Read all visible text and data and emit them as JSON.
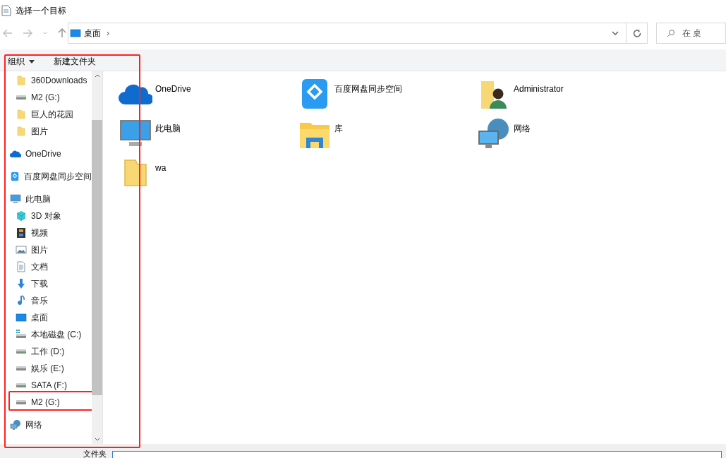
{
  "window": {
    "title": "选择一个目标"
  },
  "address_bar": {
    "location": "桌面",
    "separator": "›"
  },
  "search": {
    "placeholder": "在 桌"
  },
  "toolbar": {
    "organize": "组织",
    "new_folder": "新建文件夹"
  },
  "sidebar": {
    "annotated": true,
    "pinned_items": [
      {
        "label": "360Downloads",
        "kind": "folder"
      },
      {
        "label": "M2 (G:)",
        "kind": "drive"
      },
      {
        "label": "巨人的花园",
        "kind": "folder"
      },
      {
        "label": "图片",
        "kind": "folder"
      }
    ],
    "items": [
      {
        "label": "OneDrive",
        "kind": "onedrive"
      },
      {
        "label": "百度网盘同步空间",
        "kind": "baidu"
      },
      {
        "label": "此电脑",
        "kind": "pc",
        "children": [
          {
            "label": "3D 对象",
            "kind": "cube",
            "annotated": false
          },
          {
            "label": "视频",
            "kind": "video",
            "annotated": false
          },
          {
            "label": "图片",
            "kind": "picture",
            "annotated": false
          },
          {
            "label": "文档",
            "kind": "doc",
            "annotated": false
          },
          {
            "label": "下载",
            "kind": "download",
            "annotated": false
          },
          {
            "label": "音乐",
            "kind": "music",
            "annotated": false
          },
          {
            "label": "桌面",
            "kind": "desktop",
            "annotated": false
          },
          {
            "label": "本地磁盘 (C:)",
            "kind": "windrive",
            "annotated": false
          },
          {
            "label": "工作 (D:)",
            "kind": "drive",
            "annotated": false
          },
          {
            "label": "娱乐 (E:)",
            "kind": "drive",
            "annotated": false
          },
          {
            "label": "SATA (F:)",
            "kind": "drive",
            "annotated": false
          },
          {
            "label": "M2 (G:)",
            "kind": "drive",
            "annotated": true
          }
        ]
      },
      {
        "label": "网络",
        "kind": "network"
      }
    ]
  },
  "content_items": [
    {
      "label": "OneDrive",
      "kind": "onedrive"
    },
    {
      "label": "百度网盘同步空间",
      "kind": "baidu"
    },
    {
      "label": "Administrator",
      "kind": "user"
    },
    {
      "label": "此电脑",
      "kind": "pc"
    },
    {
      "label": "库",
      "kind": "library"
    },
    {
      "label": "网络",
      "kind": "network"
    },
    {
      "label": "wa",
      "kind": "folder"
    }
  ],
  "footer": {
    "label": "文件夹"
  }
}
